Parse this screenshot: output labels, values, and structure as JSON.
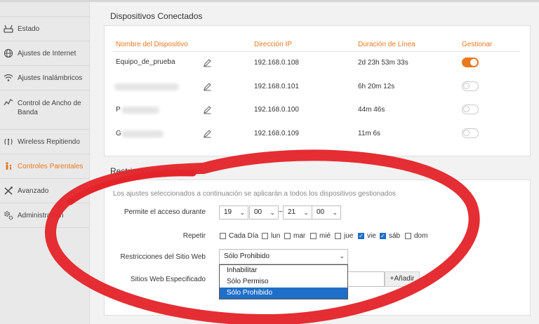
{
  "sidebar": {
    "items": [
      {
        "label": "Estado",
        "icon": "router-icon"
      },
      {
        "label": "Ajustes de Internet",
        "icon": "globe-icon"
      },
      {
        "label": "Ajustes Inalámbricos",
        "icon": "wifi-icon"
      },
      {
        "label": "Control de Ancho de Banda",
        "icon": "bandwidth-icon"
      },
      {
        "label": "Wireless Repitiendo",
        "icon": "repeater-icon"
      },
      {
        "label": "Controles Parentales",
        "icon": "family-icon",
        "active": true
      },
      {
        "label": "Avanzado",
        "icon": "tools-icon"
      },
      {
        "label": "Administración",
        "icon": "gears-icon"
      }
    ]
  },
  "devices": {
    "title": "Dispositivos Conectados",
    "headers": {
      "name": "Nombre del Dispositivo",
      "ip": "Dirección IP",
      "duration": "Duración de Línea",
      "manage": "Gestionar"
    },
    "rows": [
      {
        "name": "Equipo_de_prueba",
        "ip": "192.168.0.108",
        "duration": "2d 23h 53m 33s",
        "managed": true
      },
      {
        "name": "",
        "ip": "192.168.0.101",
        "duration": "6h 20m 12s",
        "managed": false
      },
      {
        "name": "P",
        "ip": "192.168.0.100",
        "duration": "44m 46s",
        "managed": false
      },
      {
        "name": "G",
        "ip": "192.168.0.109",
        "duration": "11m 6s",
        "managed": false
      }
    ]
  },
  "restrictions": {
    "title": "Restricciones de Acceso",
    "note": "Los ajustes seleccionados a continuación se aplicarán a todos los dispositivos gestionados",
    "access_label": "Permite el acceso durante",
    "time": {
      "start_h": "19",
      "start_m": "00",
      "end_h": "21",
      "end_m": "00",
      "separator": "~"
    },
    "repeat_label": "Repetir",
    "days": [
      {
        "label": "Cada Día",
        "checked": false
      },
      {
        "label": "lun",
        "checked": false
      },
      {
        "label": "mar",
        "checked": false
      },
      {
        "label": "mié",
        "checked": false
      },
      {
        "label": "jue",
        "checked": false
      },
      {
        "label": "vie",
        "checked": true
      },
      {
        "label": "sáb",
        "checked": true
      },
      {
        "label": "dom",
        "checked": false
      }
    ],
    "site_label": "Restricciones del Sitio Web",
    "site_value": "Sólo Prohibido",
    "site_options": [
      "Inhabilitar",
      "Sólo Permiso",
      "Sólo Prohibido"
    ],
    "sites_label": "Sitios Web Especificado",
    "add_button": "+Añadir"
  },
  "colors": {
    "accent": "#e9781e",
    "highlight": "#1f6fc8",
    "annotation": "#e3252b"
  }
}
